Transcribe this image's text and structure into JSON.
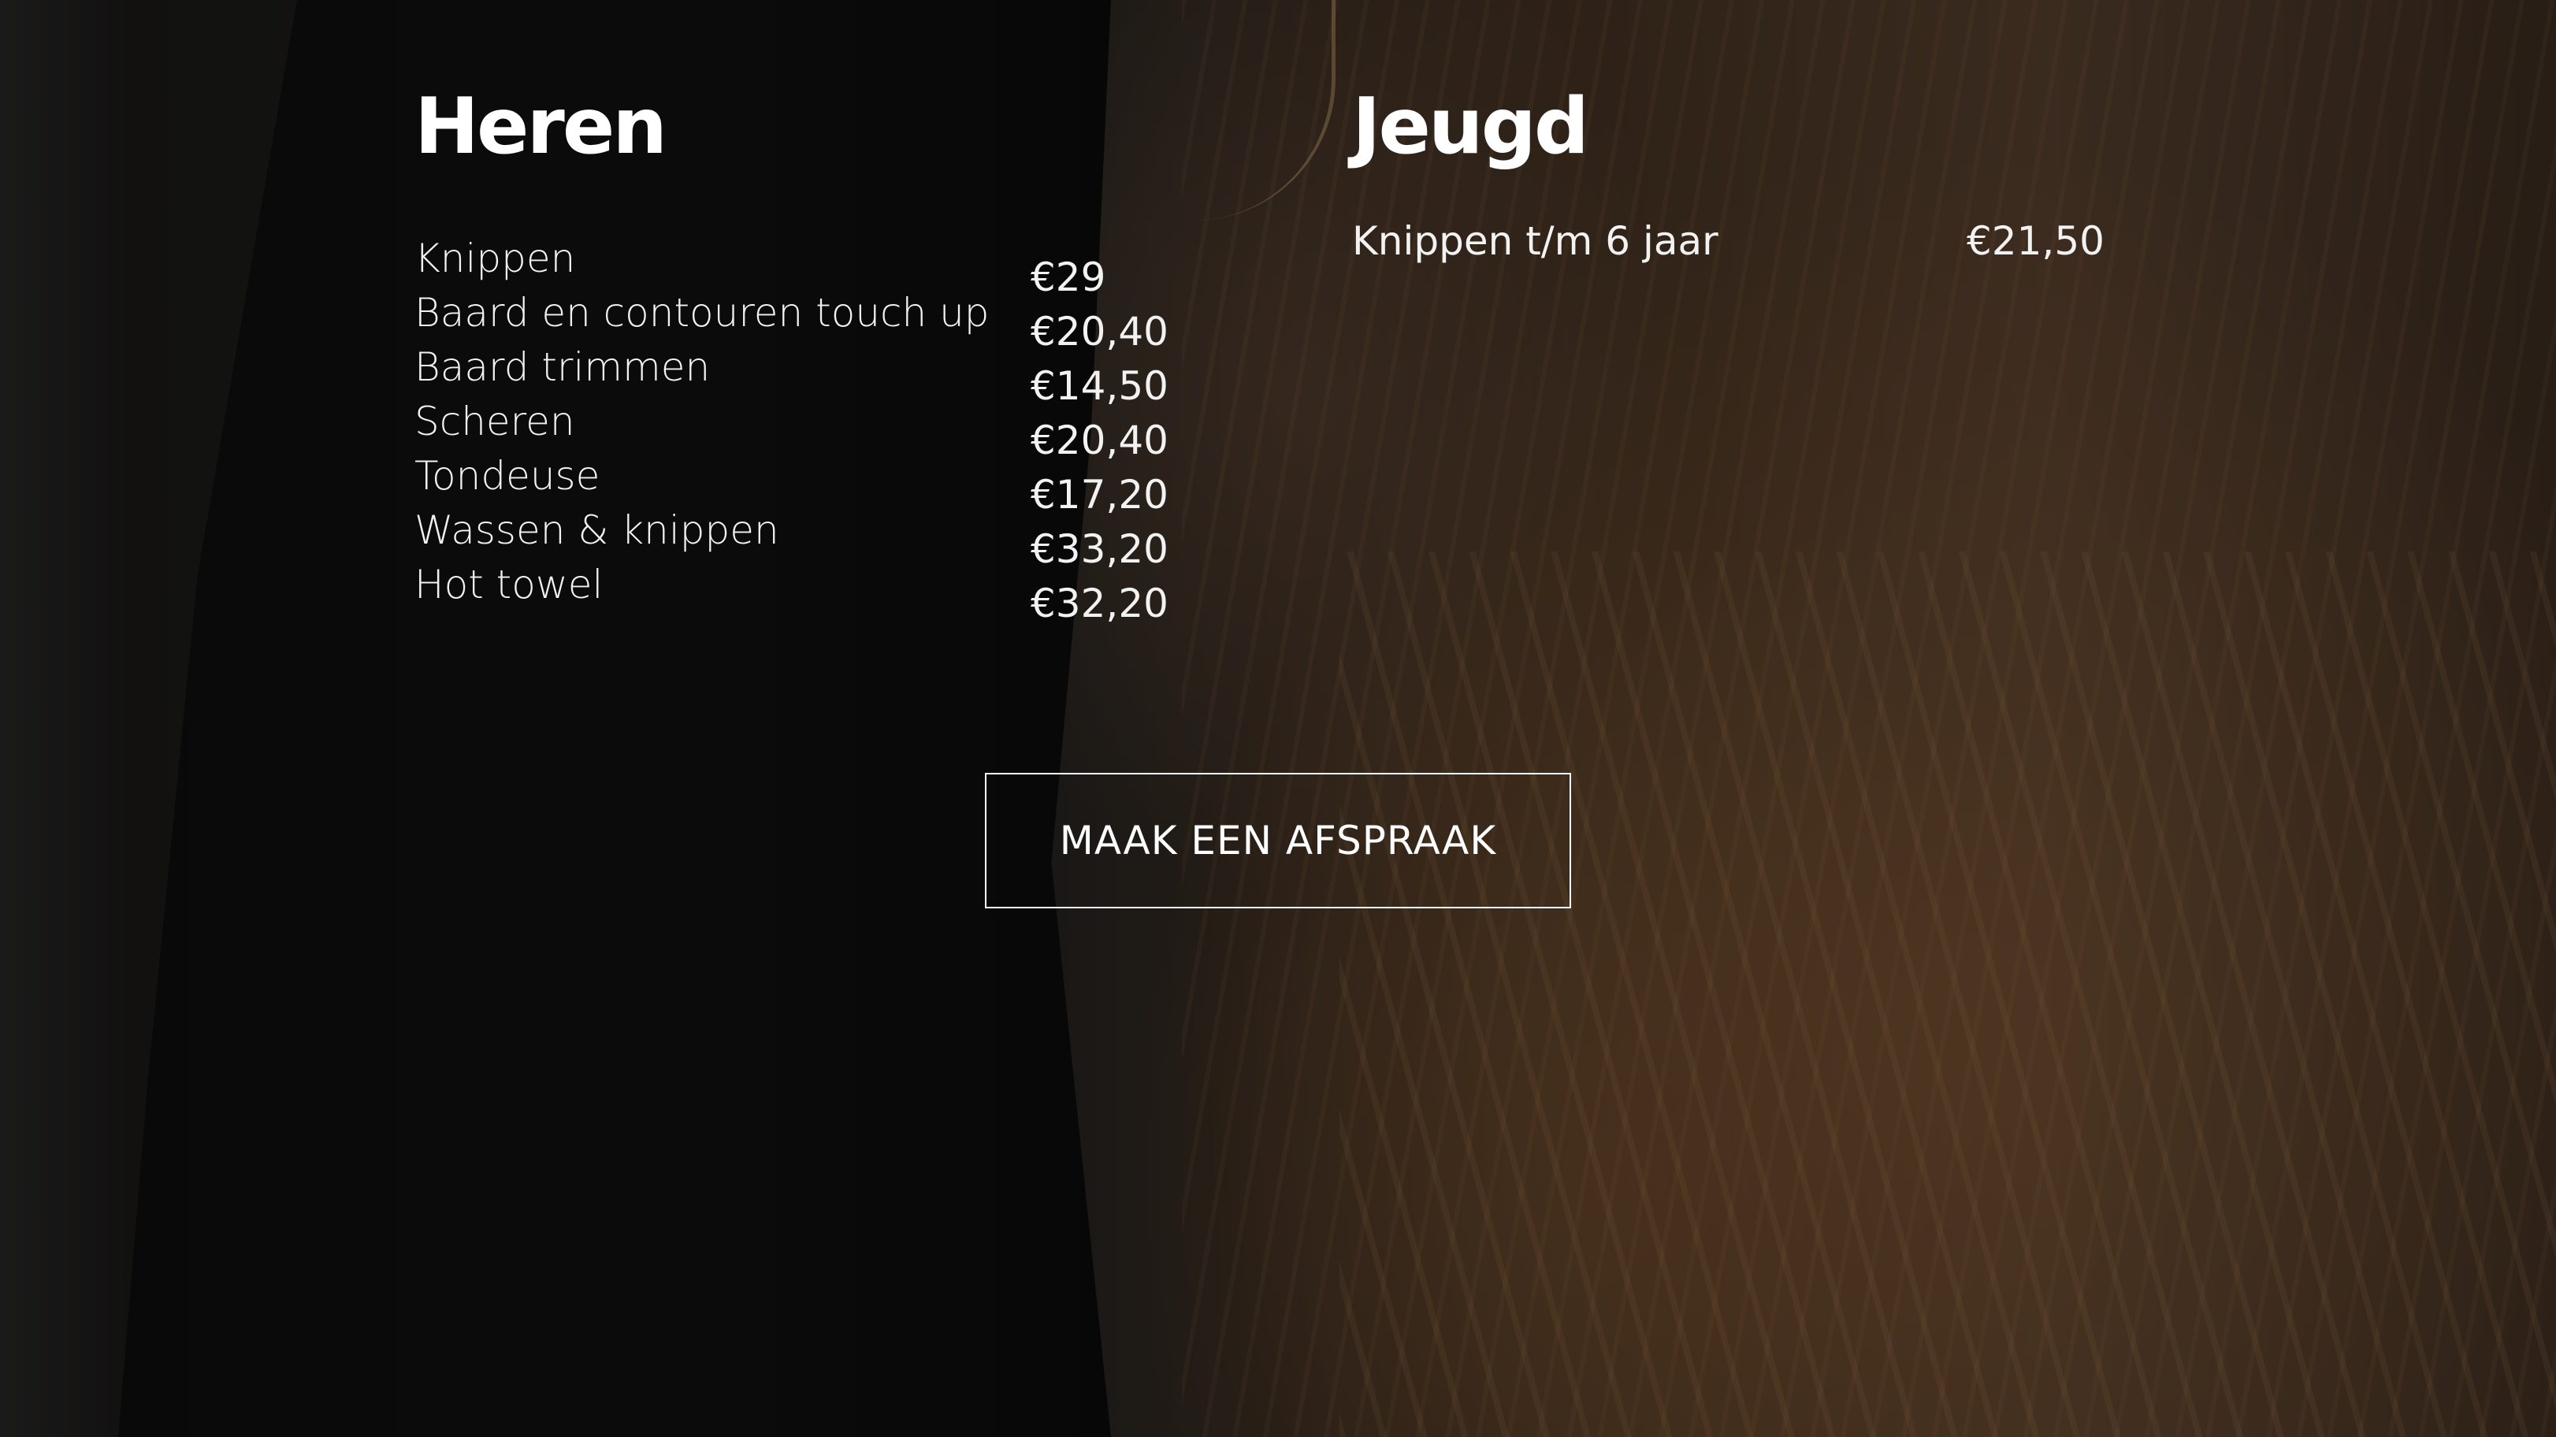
{
  "heren": {
    "title": "Heren",
    "items": [
      {
        "name": "Knippen",
        "price": "€29"
      },
      {
        "name": "Baard en contouren touch up",
        "price": "€20,40"
      },
      {
        "name": "Baard trimmen",
        "price": "€14,50"
      },
      {
        "name": "Scheren",
        "price": "€20,40"
      },
      {
        "name": "Tondeuse",
        "price": "€17,20"
      },
      {
        "name": "Wassen & knippen",
        "price": "€33,20"
      },
      {
        "name": "Hot towel",
        "price": "€32,20"
      }
    ]
  },
  "jeugd": {
    "title": "Jeugd",
    "items": [
      {
        "name": "Knippen t/m 6 jaar",
        "price": "€21,50"
      }
    ]
  },
  "cta": {
    "label": "MAAK EEN AFSPRAAK"
  },
  "background": {
    "description_icon": "photo-hair-background"
  }
}
